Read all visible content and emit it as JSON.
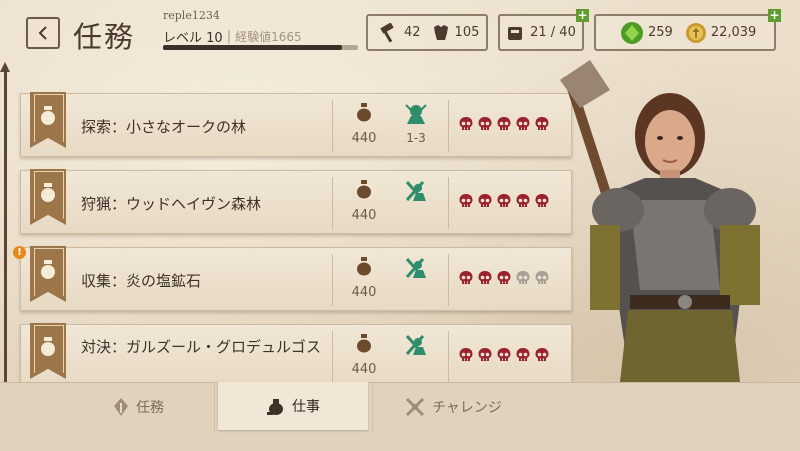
{
  "header": {
    "title": "任務",
    "username": "reple1234",
    "level_label": "レベル 10",
    "xp_label": "経験値1665",
    "xp_progress": 0.92
  },
  "resources": {
    "hammer_count": "42",
    "armor_count": "105"
  },
  "inventory": {
    "count": "21 / 40"
  },
  "currency": {
    "gems": "259",
    "gold": "22,039"
  },
  "jobs": [
    {
      "name": "探索：小さなオークの林",
      "reward": "440",
      "enemy_level": "1-3",
      "difficulty": 5
    },
    {
      "name": "狩猟：ウッドヘイヴン森林",
      "reward": "440",
      "enemy_level": "",
      "difficulty": 5
    },
    {
      "name": "収集：炎の塩鉱石",
      "reward": "440",
      "enemy_level": "",
      "difficulty": 3,
      "alert": "!"
    },
    {
      "name": "対決：ガルズール・グロデュルゴス",
      "reward": "440",
      "enemy_level": "",
      "difficulty": 5
    }
  ],
  "tabs": {
    "quests": "任務",
    "jobs": "仕事",
    "challenges": "チャレンジ"
  },
  "colors": {
    "skull_active": "#9b2230",
    "skull_inactive": "#a8a196",
    "accent_green": "#2e8d6a",
    "banner": "#9c7649"
  },
  "icons": [
    "back-icon",
    "hammer-icon",
    "armor-icon",
    "inventory-icon",
    "gem-icon",
    "gold-coin-icon",
    "coin-bag-icon",
    "enemy-icon",
    "skull-icon",
    "quest-icon",
    "jobs-icon",
    "challenge-icon"
  ]
}
